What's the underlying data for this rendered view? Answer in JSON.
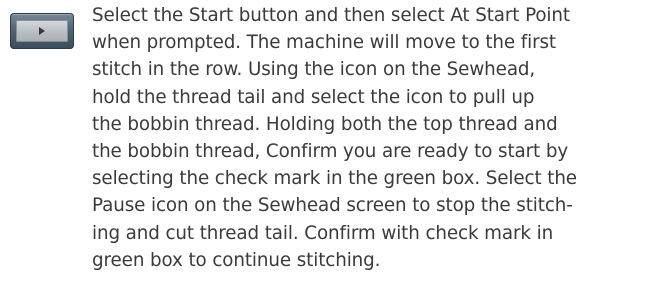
{
  "icon": {
    "name": "play-icon"
  },
  "instruction": {
    "lines": [
      "Select the Start button and then select At Start Point",
      "when prompted. The machine will move to the first",
      "stitch in the row. Using the icon on the Sewhead,",
      "hold the thread tail and select the icon to pull up",
      "the bobbin thread. Holding both the top thread and",
      "the bobbin thread, Confirm you are ready to start by",
      "selecting the check mark in the green box. Select the",
      "Pause icon on the Sewhead screen to stop the stitch-",
      "ing and cut thread tail. Confirm with check mark in",
      "green box to continue stitching."
    ]
  }
}
